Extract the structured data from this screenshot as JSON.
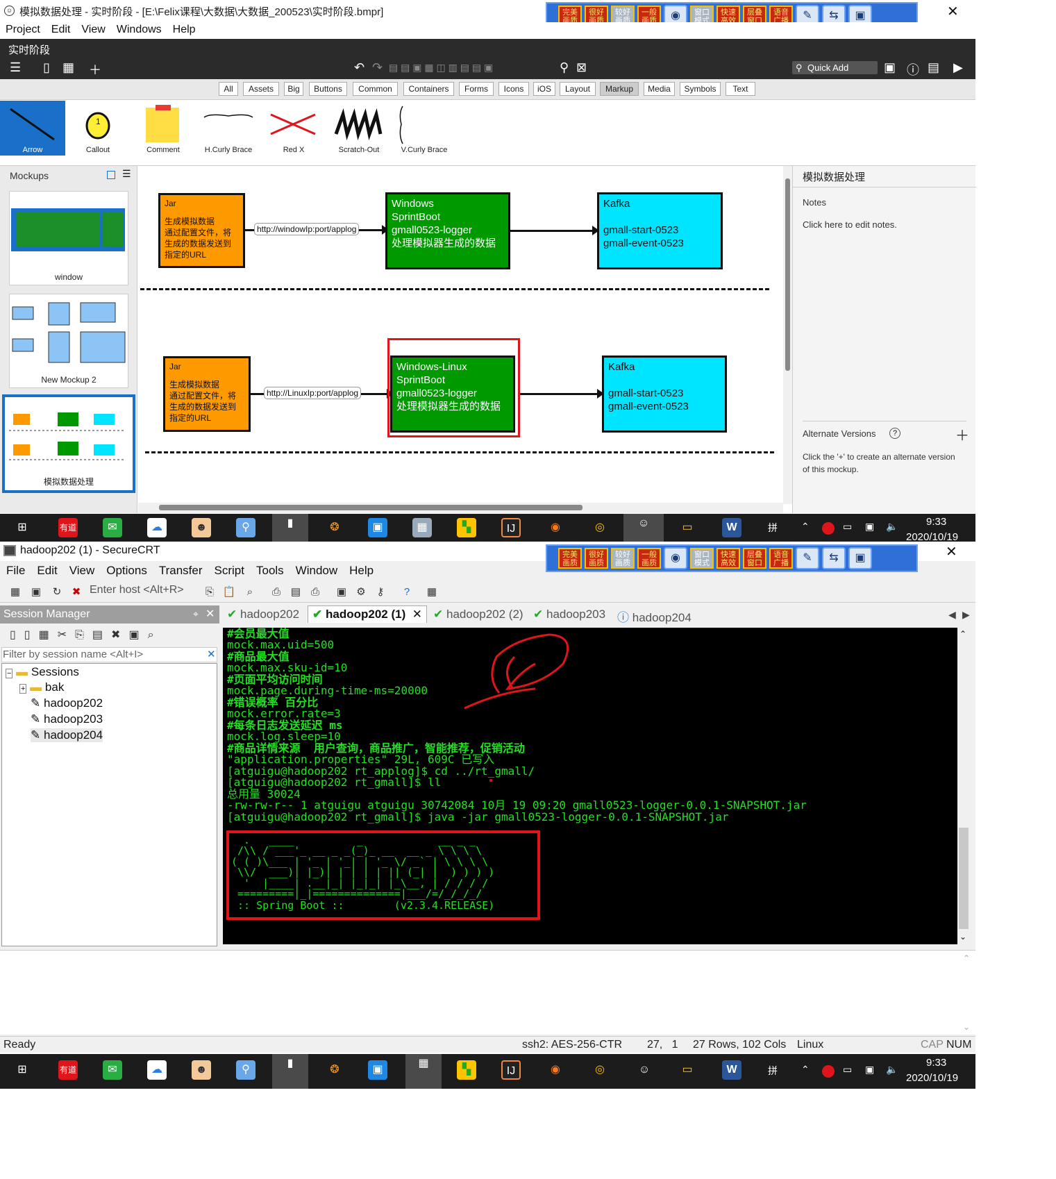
{
  "balsamiq": {
    "window_title": "模拟数据处理 - 实时阶段 - [E:\\Felix课程\\大数据\\大数据_200523\\实时阶段.bmpr]",
    "menu": [
      "Project",
      "Edit",
      "View",
      "Windows",
      "Help"
    ],
    "project_name": "实时阶段",
    "quick_add": "Quick Add",
    "lib_tabs": [
      "All",
      "Assets",
      "Big",
      "Buttons",
      "Common",
      "Containers",
      "Forms",
      "Icons",
      "iOS",
      "Layout",
      "Markup",
      "Media",
      "Symbols",
      "Text"
    ],
    "lib_tab_selected": "Markup",
    "lib_items": [
      "Arrow",
      "Callout",
      "Comment",
      "H.Curly Brace",
      "Red X",
      "Scratch-Out",
      "V.Curly Brace"
    ],
    "lib_item_selected": "Arrow",
    "mockups_header": "Mockups",
    "mockups": [
      "window",
      "New Mockup 2",
      "模拟数据处理"
    ],
    "canvas": {
      "row1": {
        "jar_title": "Jar",
        "jar_text": "生成模拟数据\n通过配置文件，将\n生成的数据发送到\n指定的URL",
        "url": "http://windowIp:port/applog",
        "server_text": "Windows\nSprintBoot\ngmall0523-logger\n处理模拟器生成的数据",
        "kafka_title": "Kafka",
        "kafka_text": "gmall-start-0523\ngmall-event-0523"
      },
      "row2": {
        "jar_title": "Jar",
        "jar_text": "生成模拟数据\n通过配置文件，将\n生成的数据发送到\n指定的URL",
        "url": "http://LinuxIp:port/applog",
        "server_text": "Windows-Linux\nSprintBoot\ngmall0523-logger\n处理模拟器生成的数据",
        "kafka_title": "Kafka",
        "kafka_text": "gmall-start-0523\ngmall-event-0523"
      }
    },
    "right_panel": {
      "title": "模拟数据处理",
      "notes_label": "Notes",
      "notes_text": "Click here to edit notes.",
      "alt_label": "Alternate Versions",
      "alt_text": "Click the '+' to create an alternate version of this mockup."
    }
  },
  "ime_buttons": [
    "完美画质",
    "很好画质",
    "较好画质",
    "一般画质",
    "窗口模式",
    "快速高效",
    "层叠窗口",
    "语音广播"
  ],
  "taskbar": {
    "time_top": "9:33",
    "date_top": "2020/10/19",
    "time": "9:33",
    "date": "2020/10/19",
    "ime": "拼",
    "youdao": "有道"
  },
  "securecrt": {
    "window_title": "hadoop202 (1) - SecureCRT",
    "menu": [
      "File",
      "Edit",
      "View",
      "Options",
      "Transfer",
      "Script",
      "Tools",
      "Window",
      "Help"
    ],
    "host_placeholder": "Enter host <Alt+R>",
    "session_manager": "Session Manager",
    "filter_placeholder": "Filter by session name <Alt+I>",
    "tree": [
      "Sessions",
      "bak",
      "hadoop202",
      "hadoop203",
      "hadoop204"
    ],
    "tabs": [
      "hadoop202",
      "hadoop202 (1)",
      "hadoop202 (2)",
      "hadoop203",
      "hadoop204"
    ],
    "active_tab": "hadoop202 (1)",
    "terminal": [
      "#会员最大值",
      "mock.max.uid=500",
      "#商品最大值",
      "mock.max.sku-id=10",
      "#页面平均访问时间",
      "mock.page.during-time-ms=20000",
      "#错误概率 百分比",
      "mock.error.rate=3",
      "#每条日志发送延迟 ms",
      "mock.log.sleep=10",
      "#商品详情来源  用户查询，商品推广，智能推荐，促销活动",
      "\"application.properties\" 29L, 609C 已写入",
      "[atguigu@hadoop202 rt_applog]$ cd ../rt_gmall/",
      "[atguigu@hadoop202 rt_gmall]$ ll",
      "总用量 30024",
      "-rw-rw-r-- 1 atguigu atguigu 30742084 10月 19 09:20 gmall0523-logger-0.0.1-SNAPSHOT.jar",
      "[atguigu@hadoop202 rt_gmall]$ java -jar gmall0523-logger-0.0.1-SNAPSHOT.jar"
    ],
    "banner": [
      "  .   ____          _            __ _ _",
      " /\\\\ / ___'_ __ _ _(_)_ __  __ _ \\ \\ \\ \\",
      "( ( )\\___ | '_ | '_| | '_ \\/ _` | \\ \\ \\ \\",
      " \\\\/  ___)| |_)| | | | | || (_| |  ) ) ) )",
      "  '  |____| .__|_| |_|_| |_\\__, | / / / /",
      " =========|_|==============|___/=/_/_/_/",
      " :: Spring Boot ::        (v2.3.4.RELEASE)"
    ],
    "status": {
      "ready": "Ready",
      "cipher": "ssh2: AES-256-CTR",
      "pos": "27,   1",
      "size": "27 Rows, 102 Cols",
      "os": "Linux",
      "cap": "CAP",
      "num": "NUM"
    }
  },
  "colors": {
    "orange": "#ff9900",
    "green": "#009900",
    "cyan": "#00e5ff",
    "terminal_bg": "#000000",
    "terminal_fg": "#22e022",
    "highlight_red": "#e0151b",
    "selected_blue": "#1a6fc8"
  }
}
